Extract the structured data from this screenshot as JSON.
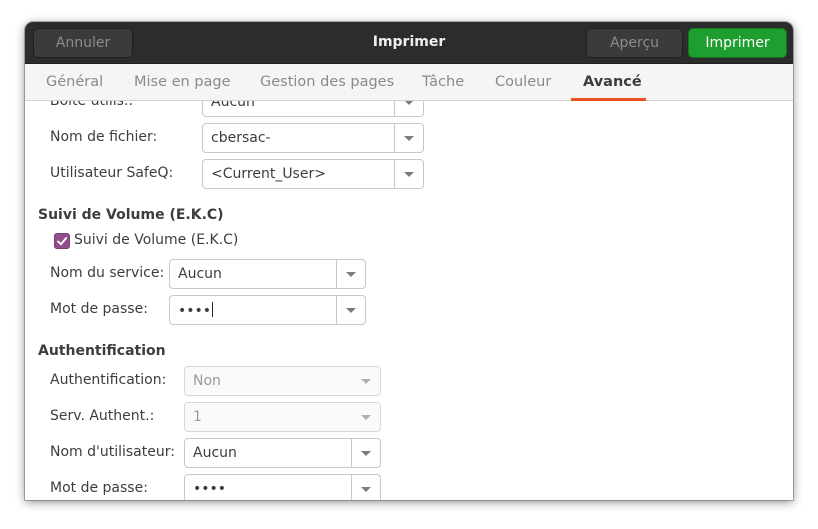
{
  "header": {
    "title": "Imprimer",
    "cancel_label": "Annuler",
    "preview_label": "Aperçu",
    "print_label": "Imprimer"
  },
  "tabs": [
    {
      "label": "Général"
    },
    {
      "label": "Mise en page"
    },
    {
      "label": "Gestion des pages"
    },
    {
      "label": "Tâche"
    },
    {
      "label": "Couleur"
    },
    {
      "label": "Avancé",
      "active": true
    }
  ],
  "form": {
    "boite": {
      "label": "Boîte utilis.:",
      "value": "Aucun"
    },
    "filename": {
      "label": "Nom de fichier:",
      "value": "cbersac-"
    },
    "safeq_user": {
      "label": "Utilisateur SafeQ:",
      "value": "<Current_User>"
    },
    "volume_section": {
      "title": "Suivi de Volume (E.K.C)",
      "checkbox_label": "Suivi de Volume (E.K.C)",
      "checked": true,
      "service": {
        "label": "Nom du service:",
        "value": "Aucun"
      },
      "password": {
        "label": "Mot de passe:",
        "value": "••••"
      }
    },
    "auth_section": {
      "title": "Authentification",
      "auth": {
        "label": "Authentification:",
        "value": "Non"
      },
      "serv": {
        "label": "Serv. Authent.:",
        "value": "1"
      },
      "username": {
        "label": "Nom d'utilisateur:",
        "value": "Aucun"
      },
      "password": {
        "label": "Mot de passe:",
        "value": "••••"
      }
    }
  },
  "colors": {
    "accent_orange": "#e95420",
    "print_green": "#1e9e2f",
    "checkbox_purple": "#924d8b",
    "header_dark": "#2c2c2c"
  }
}
